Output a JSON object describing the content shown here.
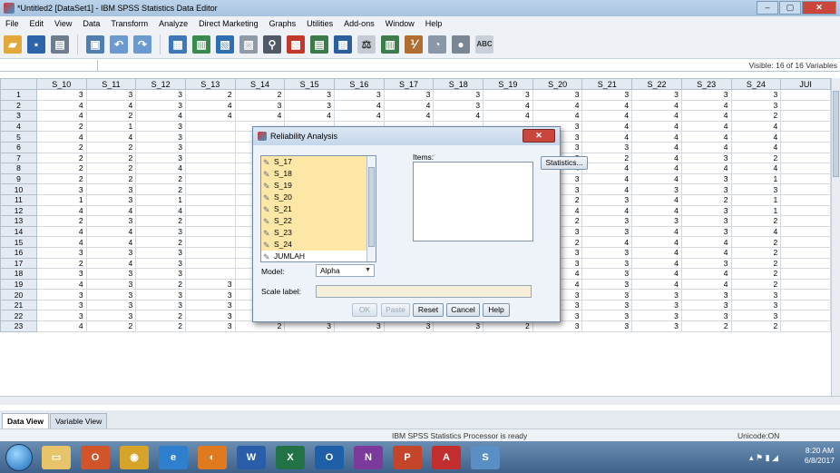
{
  "window": {
    "title": "*Untitled2 [DataSet1] - IBM SPSS Statistics Data Editor",
    "min": "–",
    "max": "▢",
    "close": "✕"
  },
  "menu": [
    "File",
    "Edit",
    "View",
    "Data",
    "Transform",
    "Analyze",
    "Direct Marketing",
    "Graphs",
    "Utilities",
    "Add-ons",
    "Window",
    "Help"
  ],
  "visible_label": "Visible: 16 of 16 Variables",
  "columns": [
    "S_10",
    "S_11",
    "S_12",
    "S_13",
    "S_14",
    "S_15",
    "S_16",
    "S_17",
    "S_18",
    "S_19",
    "S_20",
    "S_21",
    "S_22",
    "S_23",
    "S_24",
    "JUI"
  ],
  "rows": [
    {
      "n": "1",
      "v": [
        "3",
        "3",
        "3",
        "2",
        "2",
        "3",
        "3",
        "3",
        "3",
        "3",
        "3",
        "3",
        "3",
        "3",
        "3",
        ""
      ]
    },
    {
      "n": "2",
      "v": [
        "4",
        "4",
        "3",
        "4",
        "3",
        "3",
        "4",
        "4",
        "3",
        "4",
        "4",
        "4",
        "4",
        "4",
        "3",
        ""
      ]
    },
    {
      "n": "3",
      "v": [
        "4",
        "2",
        "4",
        "4",
        "4",
        "4",
        "4",
        "4",
        "4",
        "4",
        "4",
        "4",
        "4",
        "4",
        "2",
        ""
      ]
    },
    {
      "n": "4",
      "v": [
        "2",
        "1",
        "3",
        "",
        "",
        "",
        "",
        "",
        "",
        "",
        "3",
        "4",
        "4",
        "4",
        "4",
        ""
      ]
    },
    {
      "n": "5",
      "v": [
        "4",
        "4",
        "3",
        "",
        "",
        "",
        "",
        "",
        "",
        "",
        "3",
        "4",
        "4",
        "4",
        "4",
        ""
      ]
    },
    {
      "n": "6",
      "v": [
        "2",
        "2",
        "3",
        "",
        "",
        "",
        "",
        "",
        "",
        "",
        "3",
        "3",
        "4",
        "4",
        "4",
        ""
      ]
    },
    {
      "n": "7",
      "v": [
        "2",
        "2",
        "3",
        "",
        "",
        "",
        "",
        "",
        "",
        "",
        "3",
        "2",
        "4",
        "3",
        "2",
        ""
      ]
    },
    {
      "n": "8",
      "v": [
        "2",
        "2",
        "4",
        "",
        "",
        "",
        "",
        "",
        "",
        "",
        "4",
        "4",
        "4",
        "4",
        "4",
        ""
      ]
    },
    {
      "n": "9",
      "v": [
        "2",
        "2",
        "2",
        "",
        "",
        "",
        "",
        "",
        "",
        "",
        "3",
        "4",
        "4",
        "3",
        "1",
        ""
      ]
    },
    {
      "n": "10",
      "v": [
        "3",
        "3",
        "2",
        "",
        "",
        "",
        "",
        "",
        "",
        "",
        "3",
        "4",
        "3",
        "3",
        "3",
        ""
      ]
    },
    {
      "n": "11",
      "v": [
        "1",
        "3",
        "1",
        "",
        "",
        "",
        "",
        "",
        "",
        "",
        "2",
        "3",
        "4",
        "2",
        "1",
        ""
      ]
    },
    {
      "n": "12",
      "v": [
        "4",
        "4",
        "4",
        "",
        "",
        "",
        "",
        "",
        "",
        "",
        "4",
        "4",
        "4",
        "3",
        "1",
        ""
      ]
    },
    {
      "n": "13",
      "v": [
        "2",
        "3",
        "2",
        "",
        "",
        "",
        "",
        "",
        "",
        "",
        "2",
        "3",
        "3",
        "3",
        "2",
        ""
      ]
    },
    {
      "n": "14",
      "v": [
        "4",
        "4",
        "3",
        "",
        "",
        "",
        "",
        "",
        "",
        "",
        "3",
        "3",
        "4",
        "3",
        "4",
        ""
      ]
    },
    {
      "n": "15",
      "v": [
        "4",
        "4",
        "2",
        "",
        "",
        "",
        "",
        "",
        "",
        "",
        "2",
        "4",
        "4",
        "4",
        "2",
        ""
      ]
    },
    {
      "n": "16",
      "v": [
        "3",
        "3",
        "3",
        "",
        "",
        "",
        "",
        "",
        "",
        "",
        "3",
        "3",
        "4",
        "4",
        "2",
        ""
      ]
    },
    {
      "n": "17",
      "v": [
        "2",
        "4",
        "3",
        "",
        "",
        "",
        "",
        "",
        "",
        "",
        "3",
        "3",
        "4",
        "3",
        "2",
        ""
      ]
    },
    {
      "n": "18",
      "v": [
        "3",
        "3",
        "3",
        "",
        "",
        "",
        "",
        "",
        "",
        "",
        "4",
        "3",
        "4",
        "4",
        "2",
        ""
      ]
    },
    {
      "n": "19",
      "v": [
        "4",
        "3",
        "2",
        "3",
        "3",
        "2",
        "3",
        "4",
        "3",
        "4",
        "4",
        "3",
        "4",
        "4",
        "2",
        ""
      ]
    },
    {
      "n": "20",
      "v": [
        "3",
        "3",
        "3",
        "3",
        "3",
        "3",
        "4",
        "3",
        "3",
        "3",
        "3",
        "3",
        "3",
        "3",
        "3",
        ""
      ]
    },
    {
      "n": "21",
      "v": [
        "3",
        "3",
        "3",
        "3",
        "3",
        "3",
        "3",
        "3",
        "3",
        "3",
        "3",
        "3",
        "3",
        "3",
        "3",
        ""
      ]
    },
    {
      "n": "22",
      "v": [
        "3",
        "3",
        "2",
        "3",
        "3",
        "3",
        "3",
        "3",
        "3",
        "3",
        "3",
        "3",
        "3",
        "3",
        "3",
        ""
      ]
    },
    {
      "n": "23",
      "v": [
        "4",
        "2",
        "2",
        "3",
        "2",
        "3",
        "3",
        "3",
        "3",
        "2",
        "3",
        "3",
        "3",
        "2",
        "2",
        ""
      ]
    }
  ],
  "tabs": {
    "data_view": "Data View",
    "variable_view": "Variable View"
  },
  "status": {
    "processor": "IBM SPSS Statistics Processor is ready",
    "unicode": "Unicode:ON"
  },
  "taskbar": {
    "time": "8:20 AM",
    "date": "6/8/2017"
  },
  "dialog": {
    "title": "Reliability Analysis",
    "close": "✕",
    "variables": [
      "S_17",
      "S_18",
      "S_19",
      "S_20",
      "S_21",
      "S_22",
      "S_23",
      "S_24",
      "JUMLAH"
    ],
    "items_label": "Items:",
    "statistics": "Statistics...",
    "model_label": "Model:",
    "model_value": "Alpha",
    "scale_label": "Scale label:",
    "buttons": {
      "ok": "OK",
      "paste": "Paste",
      "reset": "Reset",
      "cancel": "Cancel",
      "help": "Help"
    }
  }
}
